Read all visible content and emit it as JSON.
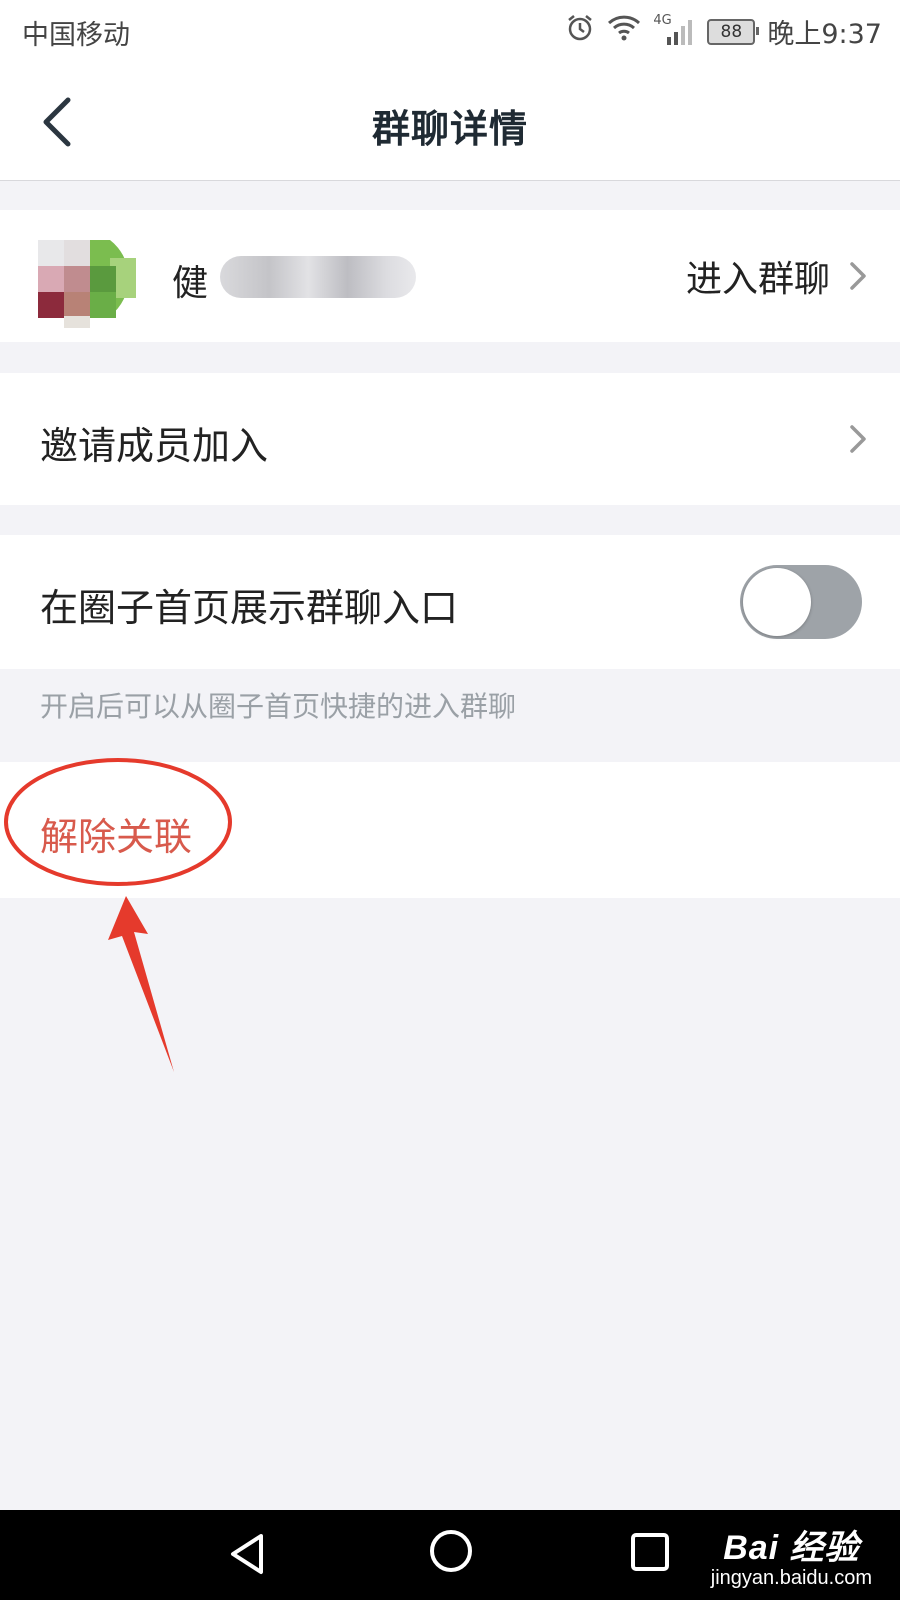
{
  "status_bar": {
    "carrier": "中国移动",
    "battery": "88",
    "network": "4G",
    "time": "晚上9:37"
  },
  "header": {
    "title": "群聊详情"
  },
  "group": {
    "name_visible": "健",
    "enter_label": "进入群聊"
  },
  "menu": {
    "invite_label": "邀请成员加入",
    "show_entry_label": "在圈子首页展示群聊入口",
    "show_entry_toggle": false,
    "show_entry_hint": "开启后可以从圈子首页快捷的进入群聊",
    "unlink_label": "解除关联"
  },
  "watermark": {
    "brand": "Bai 经验",
    "url": "jingyan.baidu.com"
  },
  "colors": {
    "unlink_text": "#d85a4c",
    "annotation": "#e53a2c",
    "toggle_off": "#9ea3a8"
  }
}
